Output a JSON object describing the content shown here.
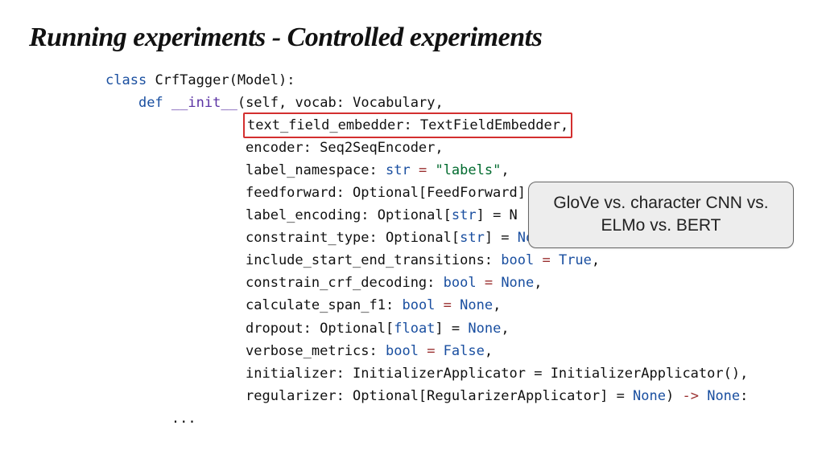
{
  "title": "Running experiments - Controlled experiments",
  "code": {
    "class_kw": "class",
    "class_name": "CrfTagger",
    "class_base": "Model",
    "def_kw": "def",
    "init": "__init__",
    "params": {
      "self": "self",
      "vocab": "vocab: Vocabulary",
      "text_field_embedder": "text_field_embedder: TextFieldEmbedder",
      "encoder": "encoder: Seq2SeqEncoder",
      "label_namespace_name": "label_namespace: ",
      "label_namespace_type": "str",
      "label_namespace_eq": " = ",
      "label_namespace_val": "\"labels\"",
      "feedforward": "feedforward: Optional[FeedForward]",
      "label_encoding_name": "label_encoding: Optional[",
      "label_encoding_type": "str",
      "label_encoding_close": "] = N",
      "constraint_type_name": "constraint_type: Optional[",
      "constraint_type_type": "str",
      "constraint_type_close": "] = ",
      "include_start_end_name": "include_start_end_transitions: ",
      "constrain_crf_name": "constrain_crf_decoding: ",
      "calculate_span_name": "calculate_span_f1: ",
      "dropout_name": "dropout: Optional[",
      "dropout_type": "float",
      "dropout_close": "] = ",
      "verbose_name": "verbose_metrics: ",
      "initializer": "initializer: InitializerApplicator = InitializerApplicator()",
      "regularizer": "regularizer: Optional[RegularizerApplicator] = ",
      "return_arrow": " -> "
    },
    "bool": "bool",
    "true": "True",
    "false": "False",
    "none": "None",
    "comma": ",",
    "ellipsis": "..."
  },
  "callout": "GloVe vs. character CNN vs. ELMo vs. BERT"
}
